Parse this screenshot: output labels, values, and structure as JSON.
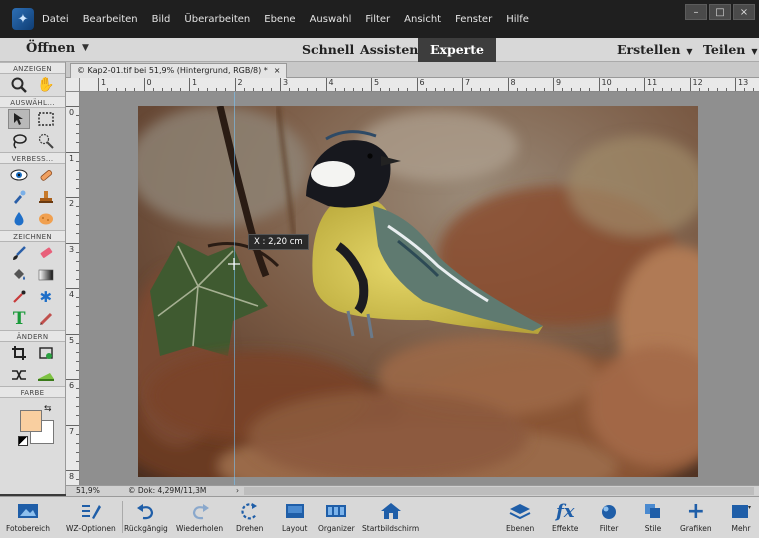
{
  "menubar": {
    "items": [
      "Datei",
      "Bearbeiten",
      "Bild",
      "Überarbeiten",
      "Ebene",
      "Auswahl",
      "Filter",
      "Ansicht",
      "Fenster",
      "Hilfe"
    ],
    "window_controls": [
      "–",
      "□",
      "×"
    ]
  },
  "modebar": {
    "open_label": "Öffnen",
    "tabs": [
      "Schnell",
      "Assistent",
      "Experte"
    ],
    "active_tab": "Experte",
    "create_label": "Erstellen",
    "share_label": "Teilen"
  },
  "toolbox": {
    "sections": [
      "ANZEIGEN",
      "AUSWÄHL...",
      "VERBESS...",
      "ZEICHNEN",
      "ÄNDERN",
      "FARBE"
    ],
    "foreground_color": "#f9cfa0",
    "background_color": "#ffffff"
  },
  "document": {
    "tab_label": "© Kap2-01.tif bei 51,9% (Hintergrund, RGB/8) *",
    "close_glyph": "×"
  },
  "rulers": {
    "h_numbers": [
      "1",
      "0",
      "1",
      "2",
      "3",
      "4",
      "5",
      "6",
      "7",
      "8",
      "9",
      "10",
      "11",
      "12",
      "13"
    ],
    "v_numbers": [
      "0",
      "1",
      "2",
      "3",
      "4",
      "5",
      "6",
      "7",
      "8"
    ]
  },
  "canvas": {
    "measure_tooltip": "X : 2,20 cm"
  },
  "status": {
    "zoom": "51,9%",
    "doc_info": "© Dok: 4,29M/11,3M",
    "arrow": "›"
  },
  "taskbar": {
    "buttons": [
      {
        "label": "Fotobereich",
        "icon": "photo-bin-icon"
      },
      {
        "label": "WZ-Optionen",
        "icon": "tool-options-icon"
      },
      {
        "label": "Rückgängig",
        "icon": "undo-icon"
      },
      {
        "label": "Wiederholen",
        "icon": "redo-icon"
      },
      {
        "label": "Drehen",
        "icon": "rotate-icon"
      },
      {
        "label": "Layout",
        "icon": "layout-icon"
      },
      {
        "label": "Organizer",
        "icon": "organizer-icon"
      },
      {
        "label": "Startbildschirm",
        "icon": "home-icon"
      },
      {
        "label": "Ebenen",
        "icon": "layers-icon"
      },
      {
        "label": "Effekte",
        "icon": "effects-icon"
      },
      {
        "label": "Filter",
        "icon": "filter-icon"
      },
      {
        "label": "Stile",
        "icon": "styles-icon"
      },
      {
        "label": "Grafiken",
        "icon": "graphics-icon"
      },
      {
        "label": "Mehr",
        "icon": "more-icon"
      }
    ]
  },
  "colors": {
    "accent": "#1f5ea8",
    "menubar_bg": "#1f1f1f",
    "panel_bg": "#d8d8d8"
  }
}
